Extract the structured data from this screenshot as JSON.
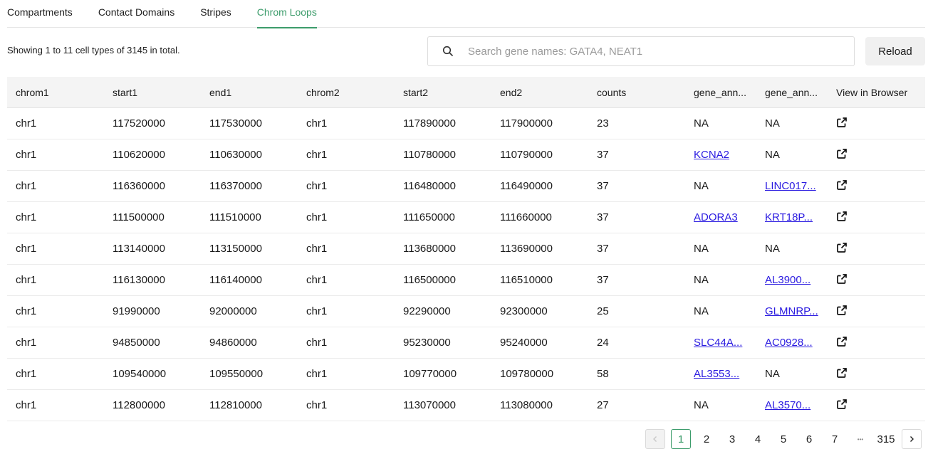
{
  "tabs": [
    {
      "label": "Compartments",
      "active": false
    },
    {
      "label": "Contact Domains",
      "active": false
    },
    {
      "label": "Stripes",
      "active": false
    },
    {
      "label": "Chrom Loops",
      "active": true
    }
  ],
  "summary": "Showing 1 to 11 cell types of 3145 in total.",
  "search": {
    "placeholder": "Search gene names: GATA4, NEAT1",
    "value": ""
  },
  "reload_label": "Reload",
  "table": {
    "headers": [
      "chrom1",
      "start1",
      "end1",
      "chrom2",
      "start2",
      "end2",
      "counts",
      "gene_ann...",
      "gene_ann...",
      "View in Browser"
    ],
    "rows": [
      {
        "chrom1": "chr1",
        "start1": "117520000",
        "end1": "117530000",
        "chrom2": "chr1",
        "start2": "117890000",
        "end2": "117900000",
        "counts": "23",
        "gene1": "NA",
        "gene1_link": false,
        "gene2": "NA",
        "gene2_link": false
      },
      {
        "chrom1": "chr1",
        "start1": "110620000",
        "end1": "110630000",
        "chrom2": "chr1",
        "start2": "110780000",
        "end2": "110790000",
        "counts": "37",
        "gene1": "KCNA2",
        "gene1_link": true,
        "gene2": "NA",
        "gene2_link": false
      },
      {
        "chrom1": "chr1",
        "start1": "116360000",
        "end1": "116370000",
        "chrom2": "chr1",
        "start2": "116480000",
        "end2": "116490000",
        "counts": "37",
        "gene1": "NA",
        "gene1_link": false,
        "gene2": "LINC017...",
        "gene2_link": true
      },
      {
        "chrom1": "chr1",
        "start1": "111500000",
        "end1": "111510000",
        "chrom2": "chr1",
        "start2": "111650000",
        "end2": "111660000",
        "counts": "37",
        "gene1": "ADORA3",
        "gene1_link": true,
        "gene2": "KRT18P...",
        "gene2_link": true
      },
      {
        "chrom1": "chr1",
        "start1": "113140000",
        "end1": "113150000",
        "chrom2": "chr1",
        "start2": "113680000",
        "end2": "113690000",
        "counts": "37",
        "gene1": "NA",
        "gene1_link": false,
        "gene2": "NA",
        "gene2_link": false
      },
      {
        "chrom1": "chr1",
        "start1": "116130000",
        "end1": "116140000",
        "chrom2": "chr1",
        "start2": "116500000",
        "end2": "116510000",
        "counts": "37",
        "gene1": "NA",
        "gene1_link": false,
        "gene2": "AL3900...",
        "gene2_link": true
      },
      {
        "chrom1": "chr1",
        "start1": "91990000",
        "end1": "92000000",
        "chrom2": "chr1",
        "start2": "92290000",
        "end2": "92300000",
        "counts": "25",
        "gene1": "NA",
        "gene1_link": false,
        "gene2": "GLMNRP...",
        "gene2_link": true
      },
      {
        "chrom1": "chr1",
        "start1": "94850000",
        "end1": "94860000",
        "chrom2": "chr1",
        "start2": "95230000",
        "end2": "95240000",
        "counts": "24",
        "gene1": "SLC44A...",
        "gene1_link": true,
        "gene2": "AC0928...",
        "gene2_link": true
      },
      {
        "chrom1": "chr1",
        "start1": "109540000",
        "end1": "109550000",
        "chrom2": "chr1",
        "start2": "109770000",
        "end2": "109780000",
        "counts": "58",
        "gene1": "AL3553...",
        "gene1_link": true,
        "gene2": "NA",
        "gene2_link": false
      },
      {
        "chrom1": "chr1",
        "start1": "112800000",
        "end1": "112810000",
        "chrom2": "chr1",
        "start2": "113070000",
        "end2": "113080000",
        "counts": "27",
        "gene1": "NA",
        "gene1_link": false,
        "gene2": "AL3570...",
        "gene2_link": true
      }
    ]
  },
  "pagination": {
    "pages": [
      "1",
      "2",
      "3",
      "4",
      "5",
      "6",
      "7",
      "•••",
      "315"
    ],
    "current": "1",
    "prev_disabled": true
  },
  "colors": {
    "accent": "#3c9c6b",
    "link": "#2a1ae0"
  },
  "icons": {
    "search": "search-icon",
    "external": "external-link-icon",
    "prev": "chevron-left-icon",
    "next": "chevron-right-icon"
  }
}
